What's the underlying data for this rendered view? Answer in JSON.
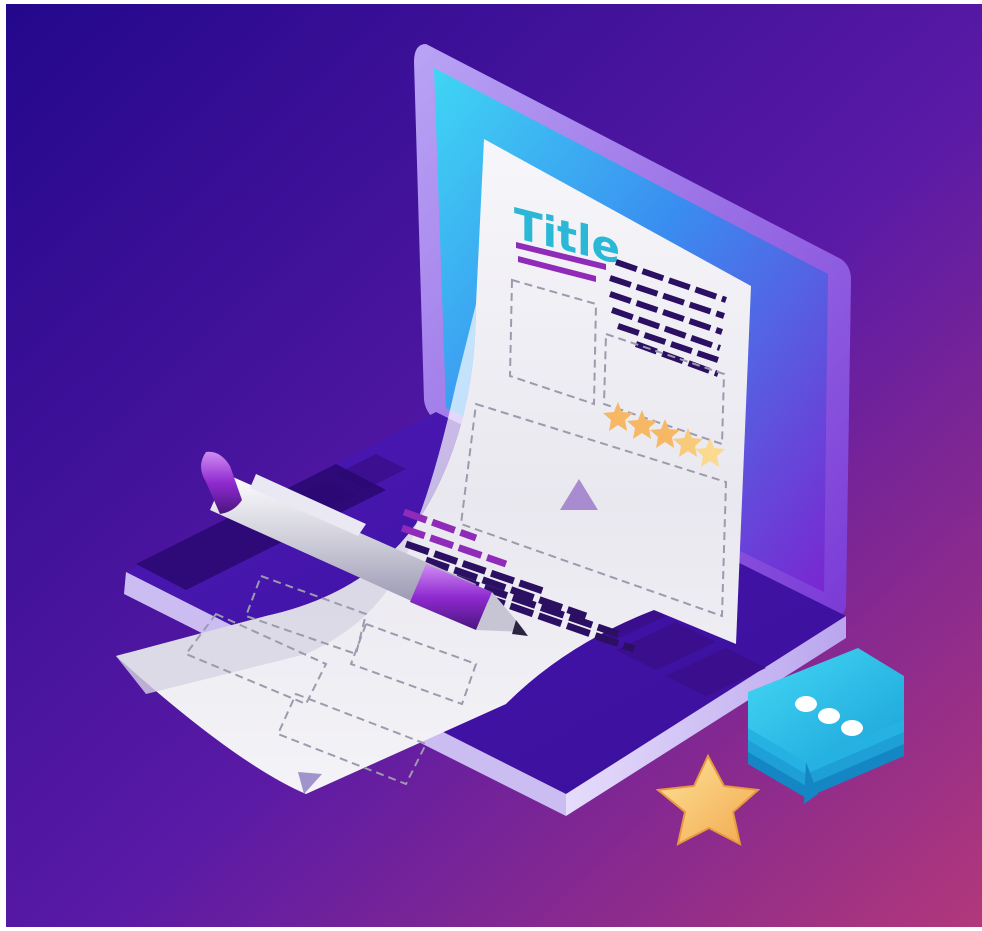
{
  "document": {
    "title": "Title"
  },
  "colors": {
    "background_top": "#2a0a8e",
    "background_bottom": "#b0357a",
    "screen_cyan": "#35c9f0",
    "screen_violet": "#6f2ad6",
    "laptop_body": "#5a1fc4",
    "paper": "#f1f0f4",
    "title_cyan": "#2bb7d6",
    "text_lines_dark": "#2a0f62",
    "text_lines_magenta": "#9a2bb8",
    "star_gold": "#f6c16a",
    "chat_cyan": "#2fc6ea"
  },
  "rating": {
    "stars_filled": 5,
    "stars_total": 5
  },
  "icons": [
    "laptop-icon",
    "document-icon",
    "pen-icon",
    "star-icon",
    "chat-bubble-icon",
    "play-triangle-icon"
  ]
}
